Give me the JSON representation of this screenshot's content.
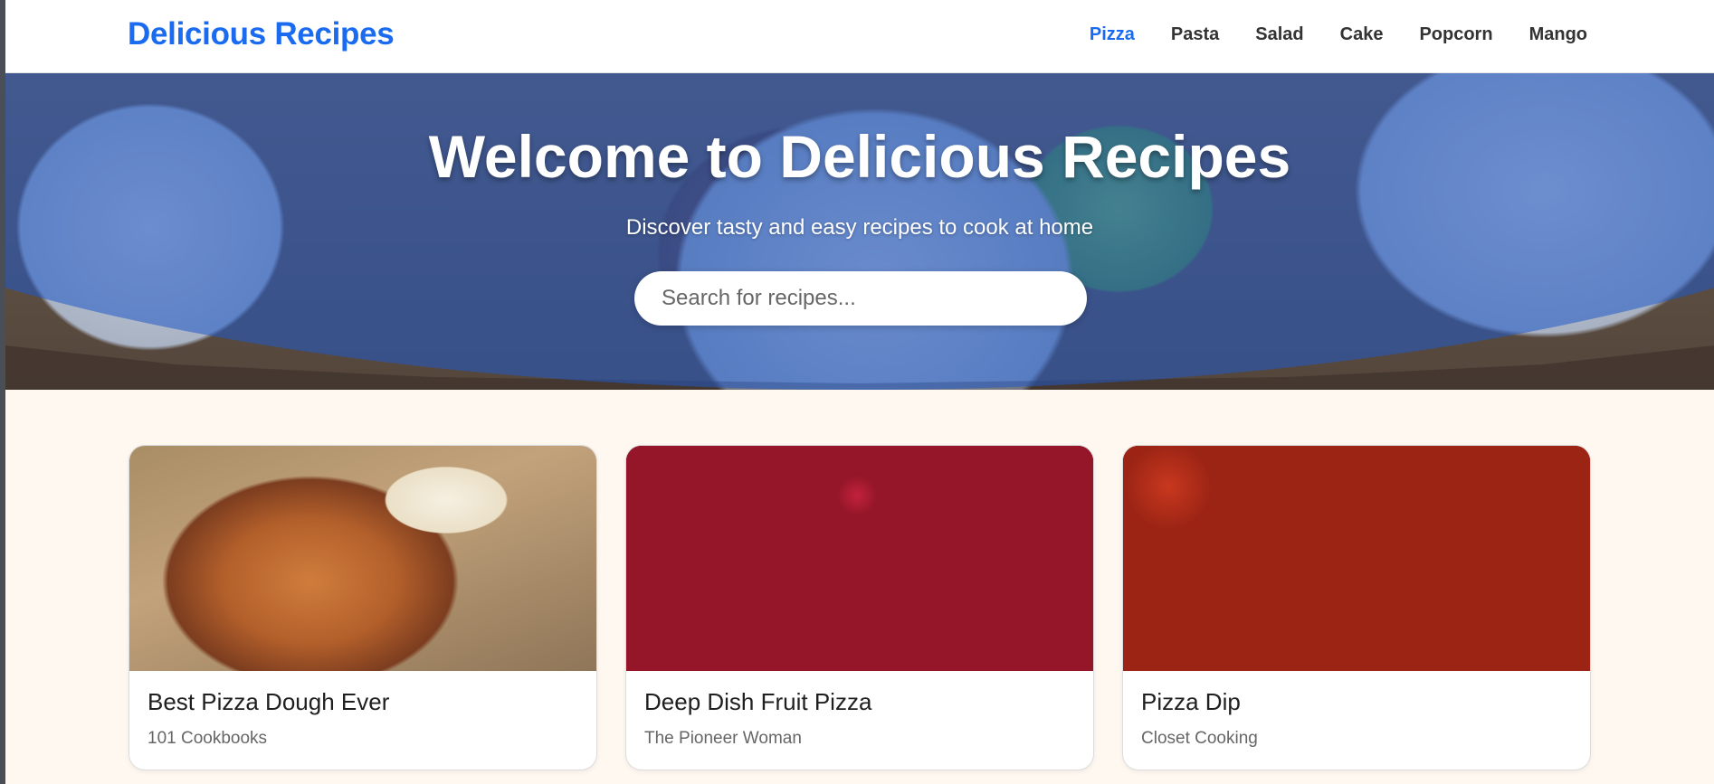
{
  "navbar": {
    "brand": "Delicious Recipes",
    "links": [
      {
        "label": "Pizza",
        "active": true
      },
      {
        "label": "Pasta",
        "active": false
      },
      {
        "label": "Salad",
        "active": false
      },
      {
        "label": "Cake",
        "active": false
      },
      {
        "label": "Popcorn",
        "active": false
      },
      {
        "label": "Mango",
        "active": false
      }
    ]
  },
  "hero": {
    "title": "Welcome to Delicious Recipes",
    "subtitle": "Discover tasty and easy recipes to cook at home",
    "search_placeholder": "Search for recipes..."
  },
  "recipes": [
    {
      "title": "Best Pizza Dough Ever",
      "source": "101 Cookbooks"
    },
    {
      "title": "Deep Dish Fruit Pizza",
      "source": "The Pioneer Woman"
    },
    {
      "title": "Pizza Dip",
      "source": "Closet Cooking"
    }
  ],
  "colors": {
    "brand": "#1a6bf0",
    "background": "#fff8f1",
    "hero_overlay": "#205ac8"
  }
}
